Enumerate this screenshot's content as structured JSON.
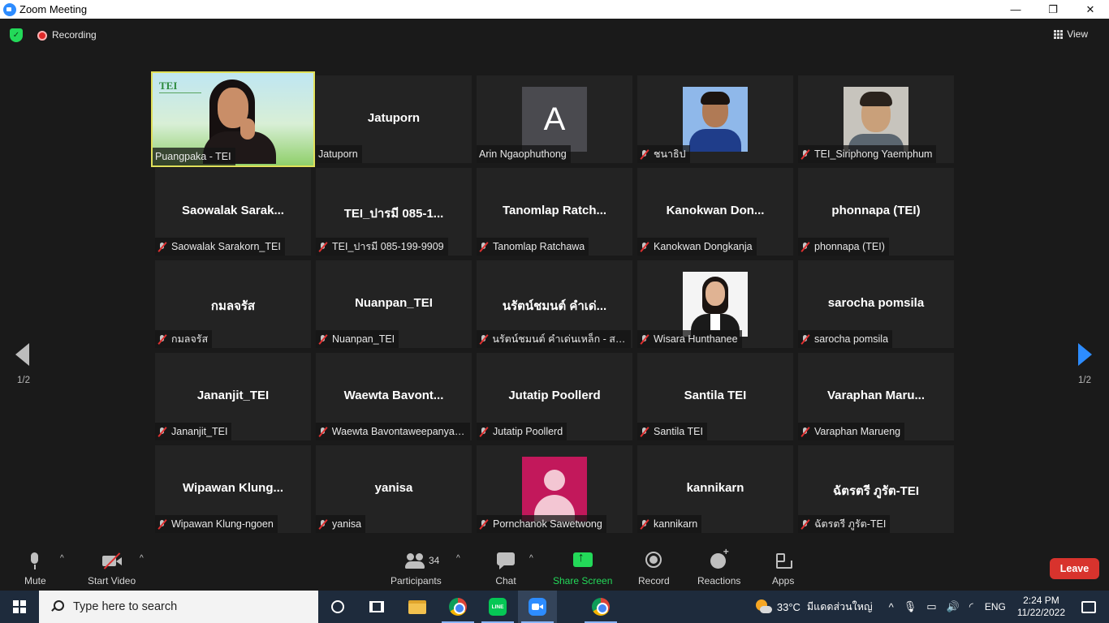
{
  "window": {
    "title": "Zoom Meeting",
    "controls": {
      "minimize": "—",
      "maximize": "❐",
      "close": "✕"
    }
  },
  "topbar": {
    "recording_label": "Recording",
    "view_label": "View"
  },
  "pagination": {
    "left_page": "1/2",
    "right_page": "1/2"
  },
  "tiles": [
    {
      "label": "Puangpaka - TEI",
      "muted": false,
      "kind": "video",
      "big": "",
      "active": true,
      "logo": "TEI"
    },
    {
      "label": "Jatuporn",
      "muted": false,
      "kind": "name",
      "big": "Jatuporn"
    },
    {
      "label": "Arin Ngaophuthong",
      "muted": false,
      "kind": "letter",
      "letter": "A"
    },
    {
      "label": "ชนาธิป",
      "muted": true,
      "kind": "photo-boy"
    },
    {
      "label": "TEI_Siriphong Yaemphum",
      "muted": true,
      "kind": "photo-man"
    },
    {
      "label": "Saowalak Sarakorn_TEI",
      "muted": true,
      "kind": "name",
      "big": "Saowalak  Sarak..."
    },
    {
      "label": "TEI_ปารมี 085-199-9909",
      "muted": true,
      "kind": "name",
      "big": "TEI_ปารมี 085-1..."
    },
    {
      "label": "Tanomlap Ratchawa",
      "muted": true,
      "kind": "name",
      "big": "Tanomlap  Ratch..."
    },
    {
      "label": "Kanokwan Dongkanja",
      "muted": true,
      "kind": "name",
      "big": "Kanokwan  Don..."
    },
    {
      "label": "phonnapa (TEI)",
      "muted": true,
      "kind": "name",
      "big": "phonnapa (TEI)"
    },
    {
      "label": "กมลจรัส",
      "muted": true,
      "kind": "name",
      "big": "กมลจรัส"
    },
    {
      "label": "Nuanpan_TEI",
      "muted": true,
      "kind": "name",
      "big": "Nuanpan_TEI"
    },
    {
      "label": "นรัตน์ชมนต์ คำเด่นเหล็ก - สถา...",
      "muted": true,
      "kind": "name",
      "big": "นรัตน์ชมนต์ คำเด่..."
    },
    {
      "label": "Wisara Hunthanee",
      "muted": true,
      "kind": "photo-woman"
    },
    {
      "label": "sarocha pomsila",
      "muted": true,
      "kind": "name",
      "big": "sarocha pomsila"
    },
    {
      "label": "Jananjit_TEI",
      "muted": true,
      "kind": "name",
      "big": "Jananjit_TEI"
    },
    {
      "label": "Waewta Bavontaweepanya_...",
      "muted": true,
      "kind": "name",
      "big": "Waewta  Bavont..."
    },
    {
      "label": "Jutatip  Poollerd",
      "muted": true,
      "kind": "name",
      "big": "Jutatip  Poollerd"
    },
    {
      "label": "Santila TEI",
      "muted": true,
      "kind": "name",
      "big": "Santila TEI"
    },
    {
      "label": "Varaphan Marueng",
      "muted": true,
      "kind": "name",
      "big": "Varaphan  Maru..."
    },
    {
      "label": "Wipawan Klung-ngoen",
      "muted": true,
      "kind": "name",
      "big": "Wipawan  Klung..."
    },
    {
      "label": "yanisa",
      "muted": true,
      "kind": "name",
      "big": "yanisa"
    },
    {
      "label": "Pornchanok Sawetwong",
      "muted": true,
      "kind": "avatar-pink"
    },
    {
      "label": "kannikarn",
      "muted": true,
      "kind": "name",
      "big": "kannikarn"
    },
    {
      "label": "ฉัตรตรี ภูรัต-TEI",
      "muted": true,
      "kind": "name",
      "big": "ฉัตรตรี ภูรัต-TEI"
    }
  ],
  "toolbar": {
    "mute_label": "Mute",
    "start_video_label": "Start Video",
    "participants_label": "Participants",
    "participants_count": "34",
    "chat_label": "Chat",
    "share_screen_label": "Share Screen",
    "record_label": "Record",
    "reactions_label": "Reactions",
    "apps_label": "Apps",
    "leave_label": "Leave",
    "caret": "^"
  },
  "taskbar": {
    "search_placeholder": "Type here to search",
    "temperature": "33°C",
    "weather_text": "มีแดดส่วนใหญ่",
    "tray_chevron": "^",
    "language": "ENG",
    "time": "2:24 PM",
    "date": "11/22/2022",
    "line_app_text": "LINE"
  },
  "colors": {
    "accent": "#2d8cff",
    "share_green": "#23d959",
    "leave_red": "#d8332d",
    "active_speaker": "#e0e05a"
  }
}
